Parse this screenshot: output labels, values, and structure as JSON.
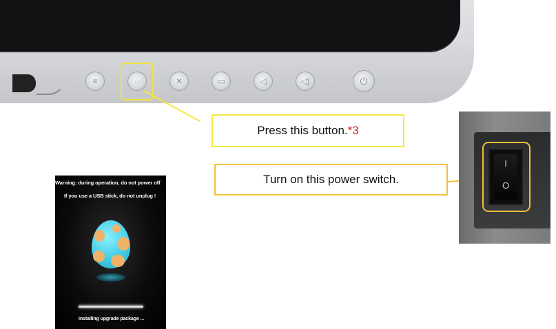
{
  "callouts": {
    "press_button_text": "Press this button.",
    "press_button_note": "*3",
    "power_switch_text": "Turn on this power switch."
  },
  "monitor": {
    "buttons": [
      {
        "name": "menu-button",
        "icon": "menu-icon",
        "glyph": "≡"
      },
      {
        "name": "select-button",
        "icon": "select-icon",
        "glyph": "◌"
      },
      {
        "name": "mute-button",
        "icon": "mute-icon",
        "glyph": "✕"
      },
      {
        "name": "input-button",
        "icon": "input-icon",
        "glyph": "▭"
      },
      {
        "name": "volume-down-button",
        "icon": "volume-down-icon",
        "glyph": "◁"
      },
      {
        "name": "volume-up-button",
        "icon": "volume-up-icon",
        "glyph": "◁)"
      },
      {
        "name": "power-button",
        "icon": "power-icon",
        "glyph": "⏻"
      }
    ],
    "highlighted_button_index": 1
  },
  "switch": {
    "on_mark": "I",
    "off_mark": "O"
  },
  "upgrade_screen": {
    "warning": "Warning: during operation, do not power off",
    "usb_notice": "If you use a USB stick, do not unplug !",
    "status": "Installing upgrade package ...",
    "progress": 1.0
  },
  "colors": {
    "callout_yellow": "#f4e93f",
    "callout_orange": "#f2bf3a",
    "note_red": "#e0201b",
    "egg_blue": "#42cde6",
    "egg_spot": "#f0b268"
  }
}
